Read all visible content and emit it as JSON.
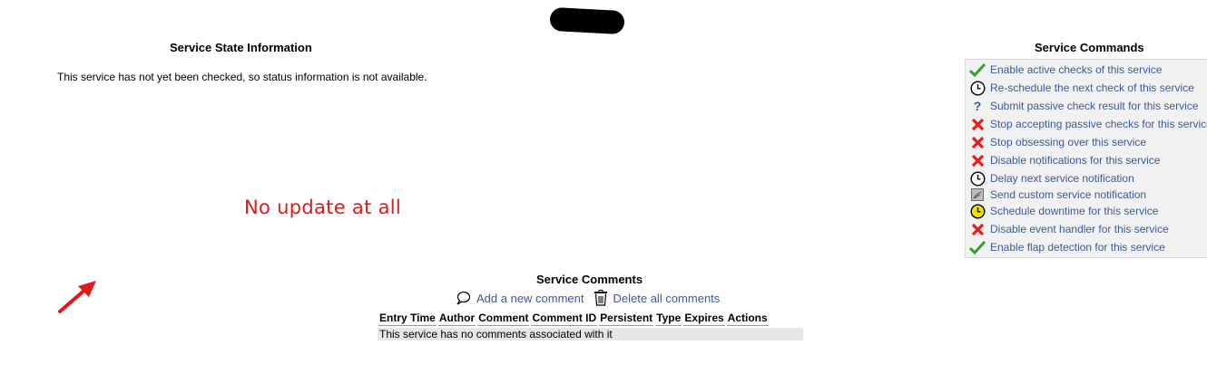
{
  "state": {
    "title": "Service State Information",
    "message": "This service has not yet been checked, so status information is not available."
  },
  "annotation": {
    "text": "No update at all",
    "color": "#e0191a"
  },
  "commands": {
    "title": "Service Commands",
    "items": [
      {
        "label": "Enable active checks of this service",
        "icon": "check-icon"
      },
      {
        "label": "Re-schedule the next check of this service",
        "icon": "clock-icon"
      },
      {
        "label": "Submit passive check result for this service",
        "icon": "question-icon"
      },
      {
        "label": "Stop accepting passive checks for this service",
        "icon": "cross-icon"
      },
      {
        "label": "Stop obsessing over this service",
        "icon": "cross-icon"
      },
      {
        "label": "Disable notifications for this service",
        "icon": "cross-icon"
      },
      {
        "label": "Delay next service notification",
        "icon": "clock-icon"
      },
      {
        "label": "Send custom service notification",
        "icon": "notification-icon"
      },
      {
        "label": "Schedule downtime for this service",
        "icon": "downtime-clock-icon"
      },
      {
        "label": "Disable event handler for this service",
        "icon": "cross-icon"
      },
      {
        "label": "Enable flap detection for this service",
        "icon": "check-icon"
      }
    ]
  },
  "comments": {
    "title": "Service Comments",
    "add_label": "Add a new comment",
    "delete_label": "Delete all comments",
    "columns": [
      "Entry Time",
      "Author",
      "Comment",
      "Comment ID",
      "Persistent",
      "Type",
      "Expires",
      "Actions"
    ],
    "empty_message": "This service has no comments associated with it"
  },
  "colors": {
    "link": "#3c5a9a",
    "panel_bg": "#f2f1f2",
    "check_green": "#2ea12e",
    "cross_red": "#e02020",
    "downtime_yellow": "#e6e600"
  }
}
